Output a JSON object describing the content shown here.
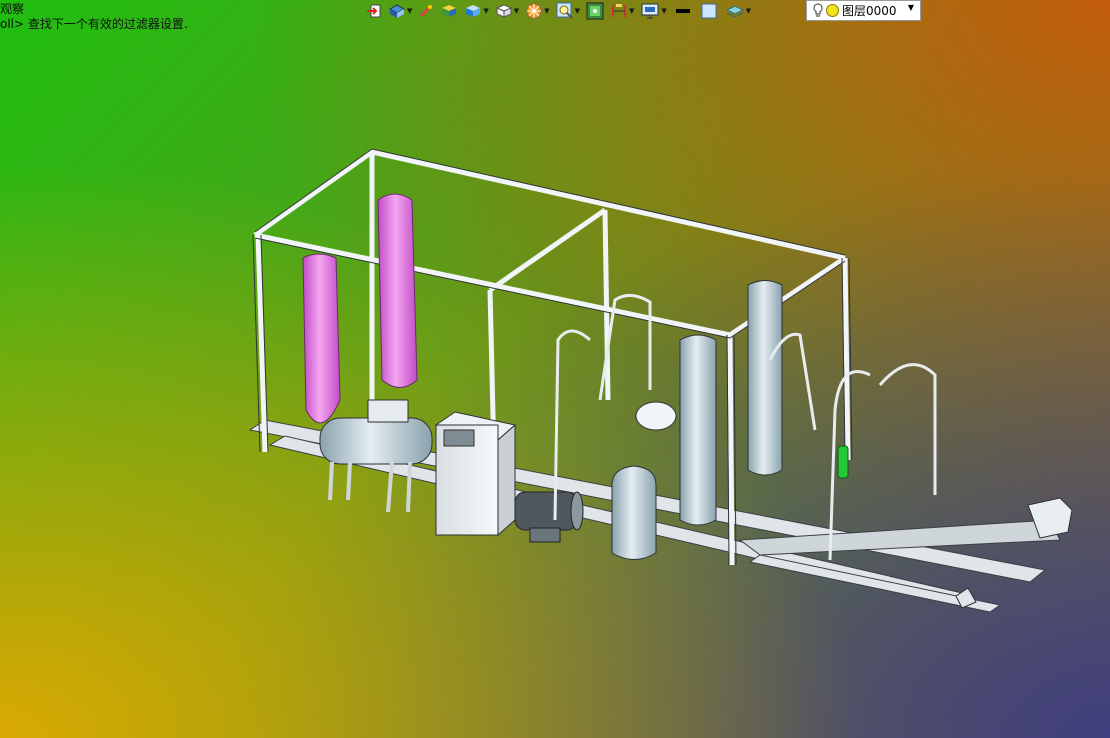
{
  "status_lines": [
    "观察",
    "oll> 查找下一个有效的过滤器设置."
  ],
  "toolbar": {
    "icons": [
      "exit-sketch-icon",
      "view-orientation-icon",
      "section-view-icon",
      "display-style-shaded-icon",
      "hide-show-icon",
      "view-cube-icon",
      "appearance-icon",
      "zoom-icon",
      "scene-icon",
      "dimension-icon",
      "display-manager-icon",
      "line-color-icon",
      "fill-color-icon",
      "layer-icon"
    ],
    "layer_name": "图层0000"
  },
  "colors": {
    "frame_steel": "#e8ecef",
    "tank_pink": "#e07ae0",
    "tank_steel": "#b9ccd4",
    "highlight_green": "#22c93a"
  }
}
